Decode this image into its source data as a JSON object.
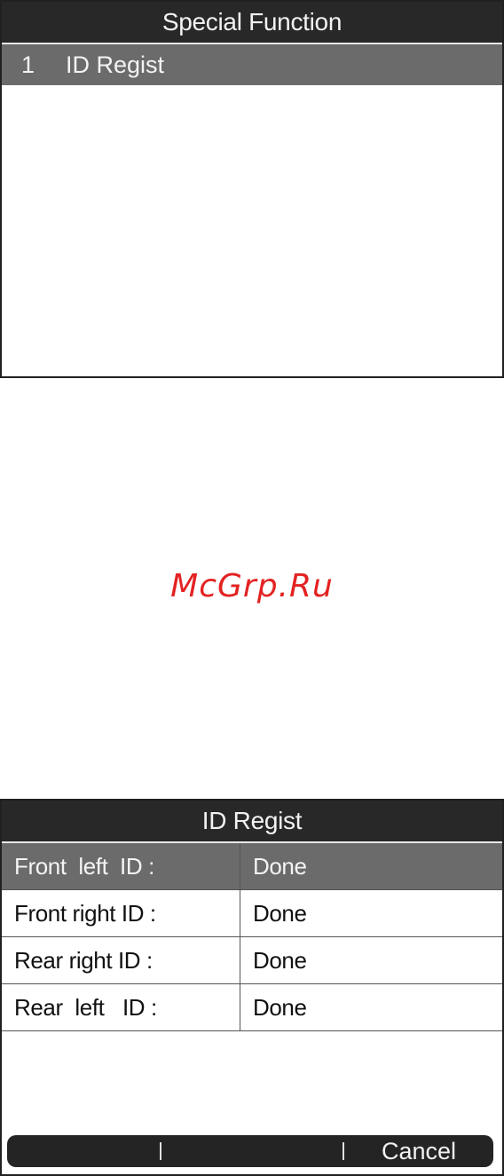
{
  "screen1": {
    "title": "Special Function",
    "items": [
      {
        "number": "1",
        "label": "ID Regist"
      }
    ]
  },
  "watermark": "McGrp.Ru",
  "screen2": {
    "title": "ID Regist",
    "rows": [
      {
        "label": "Front  left  ID :",
        "value": "Done"
      },
      {
        "label": "Front right ID :",
        "value": "Done"
      },
      {
        "label": "Rear right ID :",
        "value": "Done"
      },
      {
        "label": "Rear  left   ID :",
        "value": "Done"
      }
    ],
    "footer": {
      "cancel": "Cancel"
    }
  },
  "colors": {
    "titlebar": "#282828",
    "selected_row": "#6b6b6b",
    "watermark": "#e32222"
  }
}
